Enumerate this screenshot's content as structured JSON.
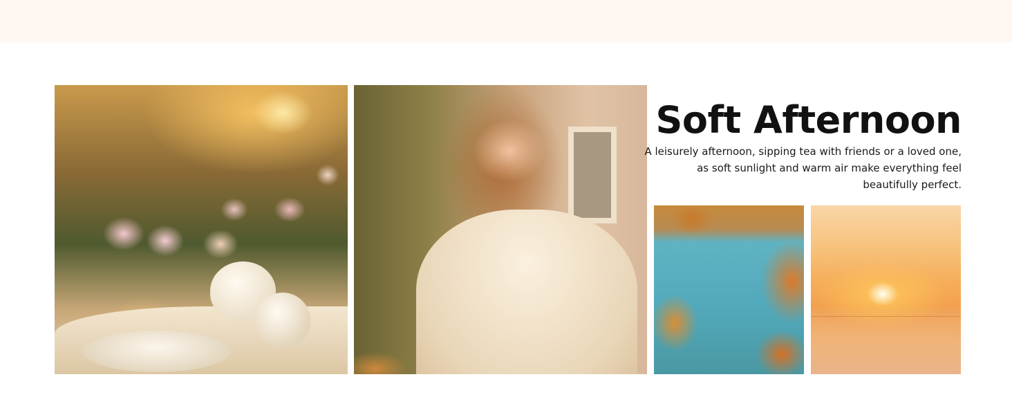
{
  "banner": {
    "title": "Soft Afternoon",
    "description": "A leisurely afternoon, sipping tea with friends or a loved one, as soft sunlight and warm air make everything feel beautifully perfect."
  },
  "images": [
    {
      "name": "tea-party-photo"
    },
    {
      "name": "woman-in-garden-photo"
    },
    {
      "name": "autumn-lake-photo"
    },
    {
      "name": "sunset-sea-photo"
    }
  ],
  "colors": {
    "top_band": "#fff7f1",
    "background": "#ffffff",
    "text": "#111111"
  }
}
